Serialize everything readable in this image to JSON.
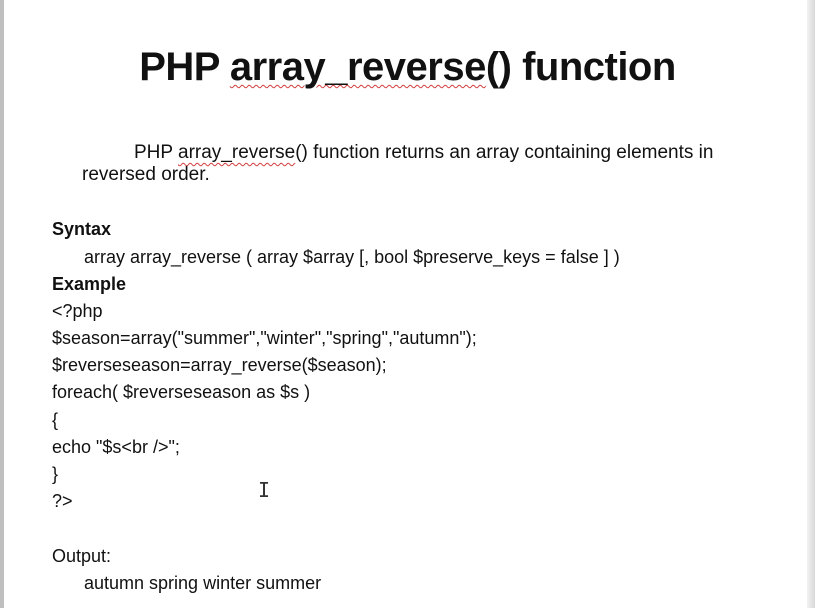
{
  "slide": {
    "title_prefix": "PHP ",
    "title_func": "array_reverse",
    "title_suffix": "() function",
    "description": {
      "prefix": "PHP ",
      "func": "array_reverse",
      "rest": "() function returns an array containing elements in reversed order."
    },
    "syntax_heading": "Syntax",
    "syntax_line": "array array_reverse ( array $array [, bool $preserve_keys  = false ] )",
    "example_heading": "Example",
    "code": {
      "line1": "<?php",
      "line2": "$season=array(\"summer\",\"winter\",\"spring\",\"autumn\");",
      "line3": "$reverseseason=array_reverse($season);",
      "line4": "foreach( $reverseseason as $s )",
      "line5": "{",
      "line6": " echo \"$s<br />\";",
      "line7": "}",
      "line8": "?>"
    },
    "output_heading": "Output:",
    "output_value": "autumn  spring  winter  summer"
  }
}
